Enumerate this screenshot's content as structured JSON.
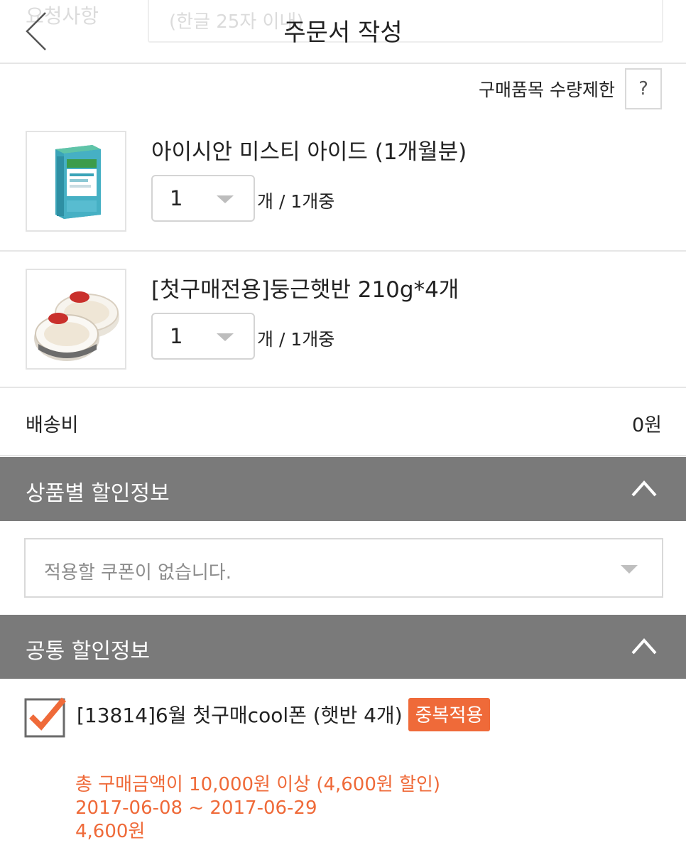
{
  "header": {
    "title": "주문서 작성",
    "ghost_label": "요청사항",
    "ghost_placeholder": "(한글 25자 이내)"
  },
  "limit": {
    "label": "구매품목 수량제한",
    "help": "?"
  },
  "items": [
    {
      "name": "아이시안 미스티 아이드 (1개월분)",
      "qty": "1",
      "qty_of": "개 / 1개중"
    },
    {
      "name": "[첫구매전용]둥근햇반 210g*4개",
      "qty": "1",
      "qty_of": "개 / 1개중"
    }
  ],
  "shipping": {
    "label": "배송비",
    "value": "0원"
  },
  "product_discount": {
    "title": "상품별 할인정보",
    "coupon_placeholder": "적용할 쿠폰이 없습니다."
  },
  "common_discount": {
    "title": "공통 할인정보",
    "coupon_name": "[13814]6월 첫구매cool폰 (햇반 4개)",
    "badge": "중복적용",
    "condition": "총 구매금액이 10,000원 이상 (4,600원 할인)",
    "period": "2017-06-08 ~ 2017-06-29",
    "amount": "4,600원",
    "checked": true
  },
  "colors": {
    "accent": "#ef6a39",
    "section_bar": "#7a7a7a"
  }
}
